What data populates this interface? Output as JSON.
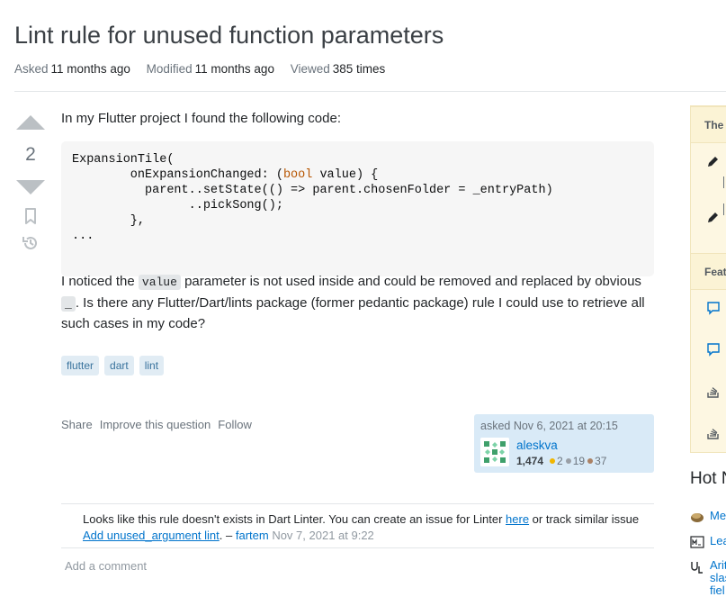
{
  "question": {
    "title": "Lint rule for unused function parameters",
    "meta": {
      "asked_label": "Asked",
      "asked_value": "11 months ago",
      "modified_label": "Modified",
      "modified_value": "11 months ago",
      "viewed_label": "Viewed",
      "viewed_value": "385 times"
    },
    "score": "2",
    "body": {
      "intro": "In my Flutter project I found the following code:",
      "code": {
        "line1": "ExpansionTile(",
        "line2_before": "        onExpansionChanged: (",
        "line2_keyword": "bool",
        "line2_after": " value) {",
        "line3": "          parent..setState(() => parent.chosenFolder = _entryPath)",
        "line4": "                ..pickSong();",
        "line5": "        },",
        "line6": "..."
      },
      "para_part1": "I noticed the ",
      "para_code1": "value",
      "para_part2": " parameter is not used inside and could be removed and replaced by obvious ",
      "para_code2": "_",
      "para_part3": ". Is there any Flutter/Dart/lints package (former pedantic package) rule I could use to retrieve all such cases in my code?"
    },
    "tags": [
      "flutter",
      "dart",
      "lint"
    ],
    "menu": {
      "share": "Share",
      "improve": "Improve this question",
      "follow": "Follow"
    },
    "owner": {
      "asked_time": "asked Nov 6, 2021 at 20:15",
      "name": "aleskva",
      "reputation": "1,474",
      "gold": "2",
      "silver": "19",
      "bronze": "37",
      "badge_colors": {
        "gold": "#f1b600",
        "silver": "#9a9fa6",
        "bronze": "#ab8265"
      }
    }
  },
  "comment": {
    "text1": "Looks like this rule doesn't exists in Dart Linter. You can create an issue for Linter ",
    "link1": "here",
    "text2": " or track similar issue ",
    "link2": "Add unused_argument lint",
    "text3": ". – ",
    "user": "fartem",
    "date": " Nov 7, 2021 at 9:22"
  },
  "add_comment": "Add a comment",
  "sidebar": {
    "box_head1": "The",
    "box_head2": "Feat",
    "hot_title": "Hot N",
    "hot_items": [
      "Met",
      "Lea",
      "Arit",
      "slas",
      "fiel"
    ]
  }
}
